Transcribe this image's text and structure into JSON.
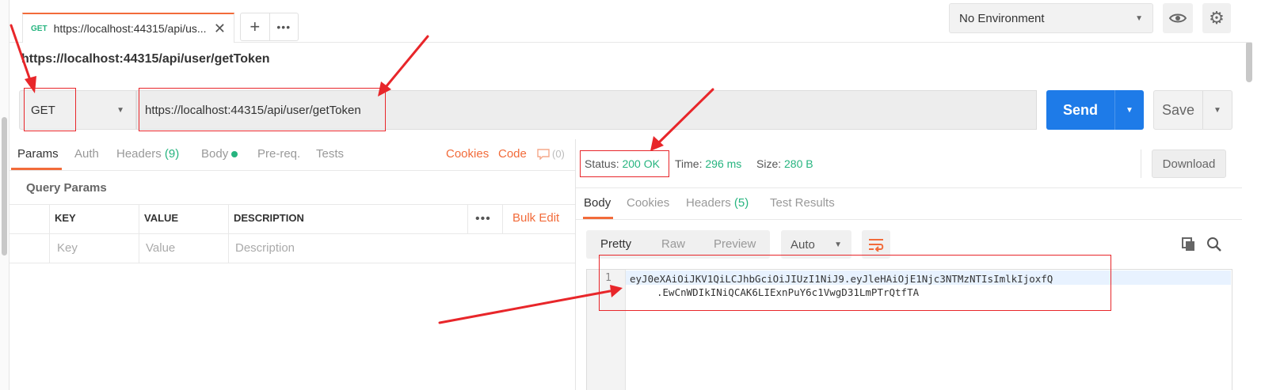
{
  "tab": {
    "method": "GET",
    "label": "https://localhost:44315/api/us...",
    "close_glyph": "✕",
    "add_glyph": "+",
    "more_glyph": "•••"
  },
  "environment": {
    "selected": "No Environment"
  },
  "request": {
    "title": "https://localhost:44315/api/user/getToken",
    "method": "GET",
    "url": "https://localhost:44315/api/user/getToken",
    "send_label": "Send",
    "save_label": "Save"
  },
  "request_tabs": {
    "params": "Params",
    "auth": "Auth",
    "headers": "Headers",
    "headers_count": "(9)",
    "body": "Body",
    "prereq": "Pre-req.",
    "tests": "Tests",
    "cookies": "Cookies",
    "code": "Code",
    "comments_count": "(0)"
  },
  "query_params": {
    "title": "Query Params",
    "columns": [
      "KEY",
      "VALUE",
      "DESCRIPTION"
    ],
    "placeholders": [
      "Key",
      "Value",
      "Description"
    ],
    "bulk_edit": "Bulk Edit"
  },
  "response": {
    "status_label": "Status:",
    "status_value": "200 OK",
    "time_label": "Time:",
    "time_value": "296 ms",
    "size_label": "Size:",
    "size_value": "280 B",
    "download_label": "Download",
    "tabs": {
      "body": "Body",
      "cookies": "Cookies",
      "headers": "Headers",
      "headers_count": "(5)",
      "test_results": "Test Results"
    },
    "view_modes": [
      "Pretty",
      "Raw",
      "Preview"
    ],
    "format": "Auto",
    "line_number": "1",
    "body_line1": "eyJ0eXAiOiJKV1QiLCJhbGciOiJIUzI1NiJ9.eyJleHAiOjE1Njc3NTMzNTIsImlkIjoxfQ",
    "body_line2": ".EwCnWDIkINiQCAK6LIExnPuY6c1VwgD31LmPTrQtfTA"
  },
  "colors": {
    "accent": "#f26b3a",
    "send": "#1e7be8",
    "success": "#26b47f",
    "annotation": "#e8262a"
  }
}
